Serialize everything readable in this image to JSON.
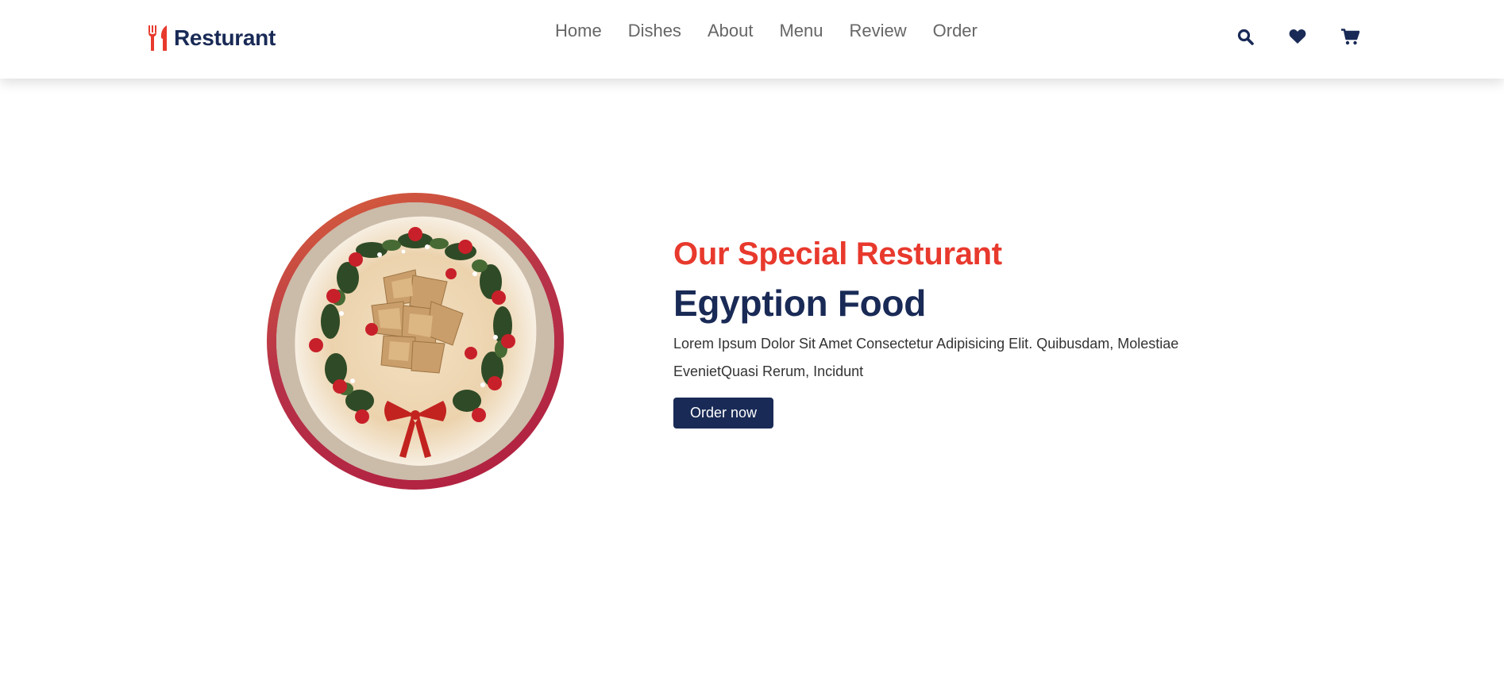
{
  "header": {
    "logo_text": "Resturant",
    "logo_icon": "utensils-icon",
    "nav": [
      {
        "label": "Home"
      },
      {
        "label": "Dishes"
      },
      {
        "label": "About"
      },
      {
        "label": "Menu"
      },
      {
        "label": "Review"
      },
      {
        "label": "Order"
      }
    ],
    "icons": [
      "search-icon",
      "heart-icon",
      "cart-icon"
    ]
  },
  "hero": {
    "subtitle": "Our Special Resturant",
    "title": "Egyption Food",
    "description": "Lorem Ipsum Dolor Sit Amet Consectetur Adipisicing Elit. Quibusdam, Molestiae EvenietQuasi Rerum, Incidunt",
    "button_label": "Order now",
    "image_alt": "food-plate-image"
  },
  "colors": {
    "accent": "#e8392d",
    "brand": "#192a56",
    "nav_text": "#666666",
    "body_text": "#333333"
  }
}
